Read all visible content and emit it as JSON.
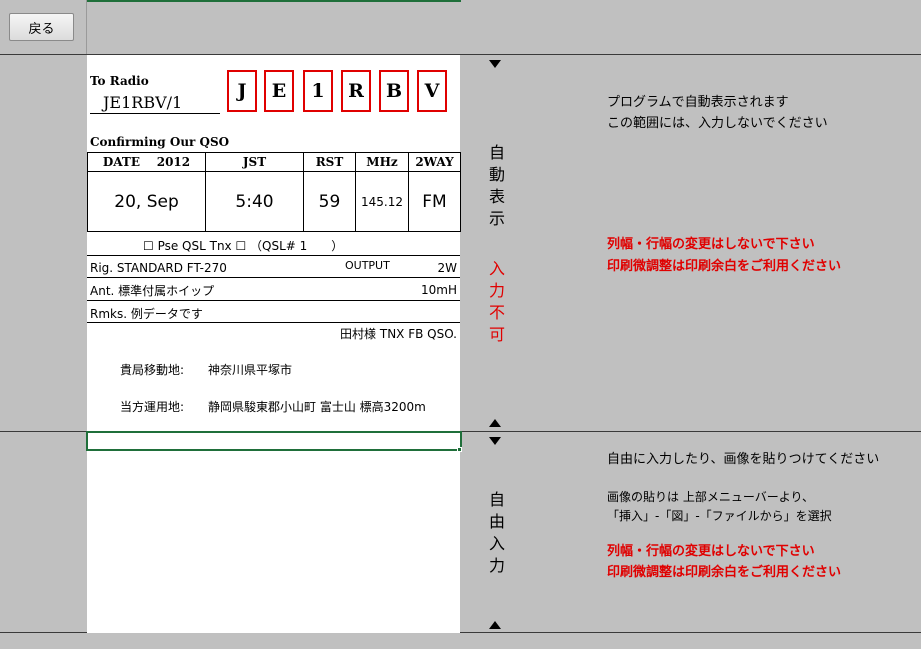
{
  "toolbar": {
    "back_label": "戻る"
  },
  "card": {
    "to_radio": "To Radio",
    "callsign": "JE1RBV/1",
    "letters": [
      "J",
      "E",
      "1",
      "R",
      "B",
      "V"
    ],
    "confirming": "Confirming Our QSO",
    "headers": {
      "date": "DATE",
      "year": "2012",
      "jst": "JST",
      "rst": "RST",
      "mhz": "MHz",
      "mode": "2WAY"
    },
    "values": {
      "date": "20, Sep",
      "jst": "5:40",
      "rst": "59",
      "mhz": "145.12",
      "mode": "FM"
    },
    "qsl_line": "☐ Pse QSL Tnx ☐ （QSL#  1　　）",
    "rig": "Rig. STANDARD FT-270",
    "output_label": "OUTPUT",
    "output_value": "2W",
    "ant": "Ant. 標準付属ホイップ",
    "ant_height": "10mH",
    "rmks": "Rmks. 例データです",
    "thanks": "田村様  TNX FB QSO.",
    "my_location_label": "貴局移動地:",
    "my_location": "神奈川県平塚市",
    "our_location_label": "当方運用地:",
    "our_location": "静岡県駿東郡小山町  富士山  標高3200m"
  },
  "side": {
    "auto_display": [
      "自",
      "動",
      "表",
      "示"
    ],
    "no_input": [
      "入",
      "力",
      "不",
      "可"
    ],
    "free_input": [
      "自",
      "由",
      "入",
      "力"
    ]
  },
  "notes": {
    "auto_1": "プログラムで自動表示されます",
    "auto_2": "この範囲には、入力しないでください",
    "warn_1": "列幅・行幅の変更はしないで下さい",
    "warn_2": "印刷微調整は印刷余白をご利用ください",
    "free_1": "自由に入力したり、画像を貼りつけてください",
    "free_2": "画像の貼りは 上部メニューバーより、",
    "free_3": "「挿入」-「図」-「ファイルから」を選択",
    "warn_3": "列幅・行幅の変更はしないで下さい",
    "warn_4": "印刷微調整は印刷余白をご利用ください"
  },
  "colors": {
    "warning": "#e00000",
    "selection": "#1f6f3a",
    "background": "#c0c0c0"
  }
}
